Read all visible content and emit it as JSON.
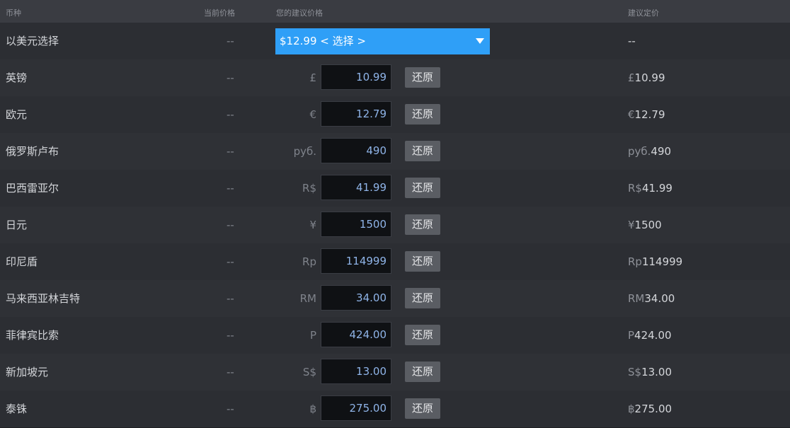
{
  "header": {
    "currency": "币种",
    "current_price": "当前价格",
    "your_suggested_price": "您的建议价格",
    "suggested_final_price": "建议定价"
  },
  "usd_row": {
    "name": "以美元选择",
    "current": "--",
    "dropdown_value": "$12.99 < 选择 >",
    "final": "--"
  },
  "reset_label": "还原",
  "rows": [
    {
      "name": "英镑",
      "current": "--",
      "symbol": "£",
      "value": "10.99",
      "final_symbol": "£",
      "final_value": "10.99"
    },
    {
      "name": "欧元",
      "current": "--",
      "symbol": "€",
      "value": "12.79",
      "final_symbol": "€",
      "final_value": "12.79"
    },
    {
      "name": "俄罗斯卢布",
      "current": "--",
      "symbol": "руб.",
      "value": "490",
      "final_symbol": "руб.",
      "final_value": "490"
    },
    {
      "name": "巴西雷亚尔",
      "current": "--",
      "symbol": "R$",
      "value": "41.99",
      "final_symbol": "R$",
      "final_value": "41.99"
    },
    {
      "name": "日元",
      "current": "--",
      "symbol": "¥",
      "value": "1500",
      "final_symbol": "¥",
      "final_value": "1500"
    },
    {
      "name": "印尼盾",
      "current": "--",
      "symbol": "Rp",
      "value": "114999",
      "final_symbol": "Rp",
      "final_value": "114999"
    },
    {
      "name": "马来西亚林吉特",
      "current": "--",
      "symbol": "RM",
      "value": "34.00",
      "final_symbol": "RM",
      "final_value": "34.00"
    },
    {
      "name": "菲律宾比索",
      "current": "--",
      "symbol": "P",
      "value": "424.00",
      "final_symbol": "P",
      "final_value": "424.00"
    },
    {
      "name": "新加坡元",
      "current": "--",
      "symbol": "S$",
      "value": "13.00",
      "final_symbol": "S$",
      "final_value": "13.00"
    },
    {
      "name": "泰铢",
      "current": "--",
      "symbol": "฿",
      "value": "275.00",
      "final_symbol": "฿",
      "final_value": "275.00"
    }
  ]
}
